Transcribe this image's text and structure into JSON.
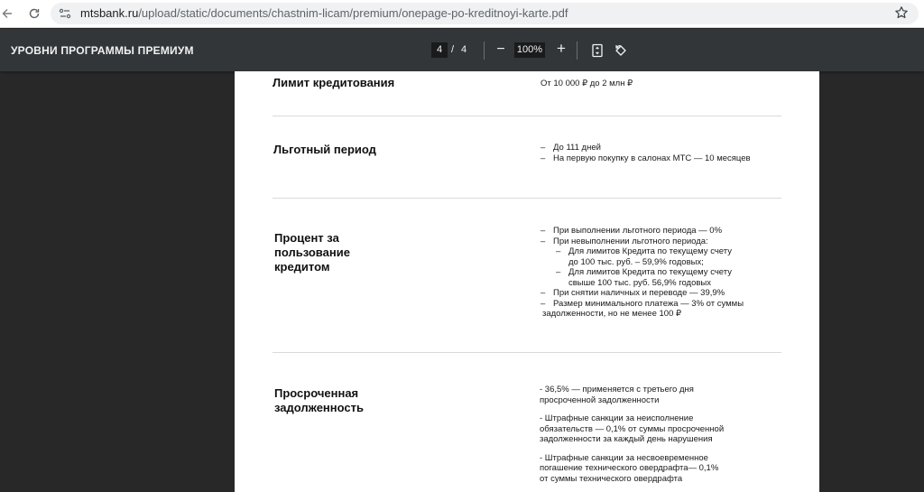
{
  "browser": {
    "url_host": "mtsbank.ru",
    "url_path": "/upload/static/documents/chastnim-licam/premium/onepage-po-kreditnoyi-karte.pdf"
  },
  "toolbar": {
    "title": "УРОВНИ ПРОГРАММЫ ПРЕМИУМ",
    "page_current": "4",
    "page_separator": "/",
    "page_total": "4",
    "zoom_out_label": "−",
    "zoom_value": "100%",
    "zoom_in_label": "+"
  },
  "page": {
    "limit": {
      "title": "Лимит кредитования",
      "value": "От 10 000 ₽ до 2 млн ₽"
    },
    "grace": {
      "title": "Льготный период",
      "items": [
        "До 111 дней",
        "На первую покупку в салонах МТС — 10 месяцев"
      ]
    },
    "interest": {
      "title_lines": [
        "Процент за",
        "пользование",
        "кредитом"
      ],
      "item1": "При выполнении льготного периода — 0%",
      "item2": "При невыполнении льготного периода:",
      "sub1_line1": "Для лимитов Кредита по текущему счету",
      "sub1_line2": "до 100 тыс. руб. – 59,9% годовых;",
      "sub2_line1": "Для лимитов Кредита по текущему счету",
      "sub2_line2": "свыше 100 тыс. руб. 56,9% годовых",
      "item3": "При снятии наличных и переводе — 39,9%",
      "item4_line1": "Размер минимального платежа — 3% от суммы",
      "item4_line2": "задолженности, но не менее 100 ₽"
    },
    "overdue": {
      "title_lines": [
        "Просроченная",
        "задолженность"
      ],
      "p1_lines": [
        "- 36,5% — применяется с третьего дня",
        "просроченной задолженности"
      ],
      "p2_lines": [
        "- Штрафные санкции за неисполнение",
        "обязательств — 0,1% от суммы просроченной",
        "задолженности за каждый день нарушения"
      ],
      "p3_lines": [
        "- Штрафные санкции за несвоевременное",
        "погашение технического  овердрафта— 0,1%",
        "от суммы технического  овердрафта"
      ]
    }
  }
}
